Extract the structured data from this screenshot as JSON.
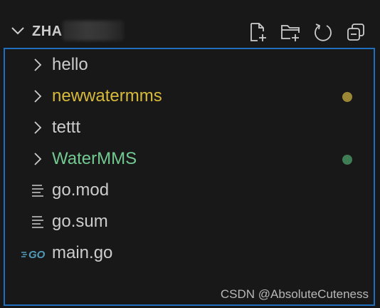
{
  "workspace": {
    "folder_name": "ZHA"
  },
  "colors": {
    "modified": "#d7ba3b",
    "untracked": "#73c991",
    "default": "#cccccc",
    "modified_dot": "#9c8735",
    "untracked_dot": "#3f7d54",
    "go_icon": "#519aba"
  },
  "toolbar": {
    "icons": [
      "new-file-icon",
      "new-folder-icon",
      "refresh-icon",
      "collapse-all-icon"
    ]
  },
  "tree": {
    "items": [
      {
        "label": "hello",
        "type": "folder",
        "status": "none"
      },
      {
        "label": "newwatermms",
        "type": "folder",
        "status": "modified"
      },
      {
        "label": "tettt",
        "type": "folder",
        "status": "none"
      },
      {
        "label": "WaterMMS",
        "type": "folder",
        "status": "untracked"
      },
      {
        "label": "go.mod",
        "type": "file",
        "icon": "lines-icon"
      },
      {
        "label": "go.sum",
        "type": "file",
        "icon": "lines-icon"
      },
      {
        "label": "main.go",
        "type": "file",
        "icon": "go-icon",
        "icon_text": "GO"
      }
    ]
  },
  "watermark": "CSDN @AbsoluteCuteness"
}
